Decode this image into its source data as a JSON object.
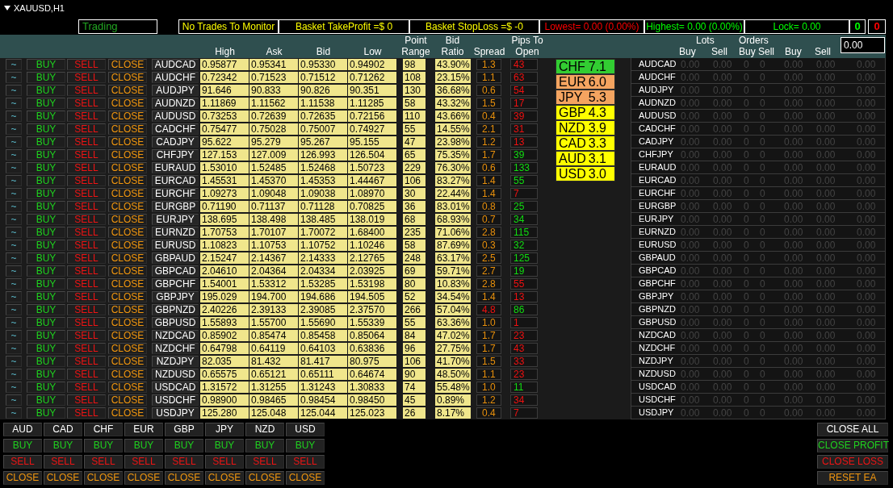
{
  "window": {
    "title": "XAUUSD,H1"
  },
  "mode": "Trading",
  "status": [
    {
      "text": "No Trades To Monitor",
      "color": "#ffff00"
    },
    {
      "text": "Basket TakeProfit =$ 0",
      "color": "#ffff00"
    },
    {
      "text": "Basket StopLoss =$ -0",
      "color": "#ffff00"
    },
    {
      "text": "Lowest= 0.00 (0.00%)",
      "color": "#ff0000"
    },
    {
      "text": "Highest= 0.00 (0.00%)",
      "color": "#00ff00"
    },
    {
      "text": "Lock= 0.00",
      "color": "#00ff00"
    },
    {
      "text": "0",
      "color": "#00ff00"
    },
    {
      "text": "0",
      "color": "#ff0000"
    }
  ],
  "table": {
    "columns": [
      "High",
      "Ask",
      "Bid",
      "Low",
      "Point Range",
      "Bid Ratio",
      "Spread",
      "Pips To Open"
    ],
    "rows": [
      {
        "actions": [
          "~",
          "BUY",
          "SELL",
          "CLOSE"
        ],
        "pair": "AUDCAD",
        "high": "0.95877",
        "ask": "0.95341",
        "bid": "0.95330",
        "low": "0.94902",
        "point_range": "98",
        "bid_ratio": "43.90%",
        "spread": {
          "text": "1.3",
          "color": "#e8900c"
        },
        "pips_to_open": {
          "text": "43",
          "color": "#ee1111"
        }
      },
      {
        "actions": [
          "~",
          "BUY",
          "SELL",
          "CLOSE"
        ],
        "pair": "AUDCHF",
        "high": "0.72342",
        "ask": "0.71523",
        "bid": "0.71512",
        "low": "0.71262",
        "point_range": "108",
        "bid_ratio": "23.15%",
        "spread": {
          "text": "1.1",
          "color": "#e8900c"
        },
        "pips_to_open": {
          "text": "63",
          "color": "#ee1111"
        }
      },
      {
        "actions": [
          "~",
          "BUY",
          "SELL",
          "CLOSE"
        ],
        "pair": "AUDJPY",
        "high": "91.646",
        "ask": "90.833",
        "bid": "90.826",
        "low": "90.351",
        "point_range": "130",
        "bid_ratio": "36.68%",
        "spread": {
          "text": "0.6",
          "color": "#e8900c"
        },
        "pips_to_open": {
          "text": "54",
          "color": "#ee1111"
        }
      },
      {
        "actions": [
          "~",
          "BUY",
          "SELL",
          "CLOSE"
        ],
        "pair": "AUDNZD",
        "high": "1.11869",
        "ask": "1.11562",
        "bid": "1.11538",
        "low": "1.11285",
        "point_range": "58",
        "bid_ratio": "43.32%",
        "spread": {
          "text": "1.5",
          "color": "#e8900c"
        },
        "pips_to_open": {
          "text": "17",
          "color": "#ee1111"
        }
      },
      {
        "actions": [
          "~",
          "BUY",
          "SELL",
          "CLOSE"
        ],
        "pair": "AUDUSD",
        "high": "0.73253",
        "ask": "0.72639",
        "bid": "0.72635",
        "low": "0.72156",
        "point_range": "110",
        "bid_ratio": "43.66%",
        "spread": {
          "text": "0.4",
          "color": "#e8900c"
        },
        "pips_to_open": {
          "text": "39",
          "color": "#ee1111"
        }
      },
      {
        "actions": [
          "~",
          "BUY",
          "SELL",
          "CLOSE"
        ],
        "pair": "CADCHF",
        "high": "0.75477",
        "ask": "0.75028",
        "bid": "0.75007",
        "low": "0.74927",
        "point_range": "55",
        "bid_ratio": "14.55%",
        "spread": {
          "text": "2.1",
          "color": "#e8900c"
        },
        "pips_to_open": {
          "text": "31",
          "color": "#ee1111"
        }
      },
      {
        "actions": [
          "~",
          "BUY",
          "SELL",
          "CLOSE"
        ],
        "pair": "CADJPY",
        "high": "95.622",
        "ask": "95.279",
        "bid": "95.267",
        "low": "95.155",
        "point_range": "47",
        "bid_ratio": "23.98%",
        "spread": {
          "text": "1.2",
          "color": "#e8900c"
        },
        "pips_to_open": {
          "text": "13",
          "color": "#ee1111"
        }
      },
      {
        "actions": [
          "~",
          "BUY",
          "SELL",
          "CLOSE"
        ],
        "pair": "CHFJPY",
        "high": "127.153",
        "ask": "127.009",
        "bid": "126.993",
        "low": "126.504",
        "point_range": "65",
        "bid_ratio": "75.35%",
        "spread": {
          "text": "1.7",
          "color": "#e8900c"
        },
        "pips_to_open": {
          "text": "39",
          "color": "#11dd11"
        }
      },
      {
        "actions": [
          "~",
          "BUY",
          "SELL",
          "CLOSE"
        ],
        "pair": "EURAUD",
        "high": "1.53010",
        "ask": "1.52485",
        "bid": "1.52468",
        "low": "1.50723",
        "point_range": "229",
        "bid_ratio": "76.30%",
        "spread": {
          "text": "0.6",
          "color": "#e8900c"
        },
        "pips_to_open": {
          "text": "133",
          "color": "#11dd11"
        }
      },
      {
        "actions": [
          "~",
          "BUY",
          "SELL",
          "CLOSE"
        ],
        "pair": "EURCAD",
        "high": "1.45531",
        "ask": "1.45370",
        "bid": "1.45353",
        "low": "1.44467",
        "point_range": "106",
        "bid_ratio": "83.27%",
        "spread": {
          "text": "1.4",
          "color": "#e8900c"
        },
        "pips_to_open": {
          "text": "55",
          "color": "#11dd11"
        }
      },
      {
        "actions": [
          "~",
          "BUY",
          "SELL",
          "CLOSE"
        ],
        "pair": "EURCHF",
        "high": "1.09273",
        "ask": "1.09048",
        "bid": "1.09038",
        "low": "1.08970",
        "point_range": "30",
        "bid_ratio": "22.44%",
        "spread": {
          "text": "1.4",
          "color": "#e8900c"
        },
        "pips_to_open": {
          "text": "7",
          "color": "#ee1111"
        }
      },
      {
        "actions": [
          "~",
          "BUY",
          "SELL",
          "CLOSE"
        ],
        "pair": "EURGBP",
        "high": "0.71190",
        "ask": "0.71137",
        "bid": "0.71128",
        "low": "0.70825",
        "point_range": "36",
        "bid_ratio": "83.01%",
        "spread": {
          "text": "0.8",
          "color": "#e8900c"
        },
        "pips_to_open": {
          "text": "25",
          "color": "#11dd11"
        }
      },
      {
        "actions": [
          "~",
          "BUY",
          "SELL",
          "CLOSE"
        ],
        "pair": "EURJPY",
        "high": "138.695",
        "ask": "138.498",
        "bid": "138.485",
        "low": "138.019",
        "point_range": "68",
        "bid_ratio": "68.93%",
        "spread": {
          "text": "0.7",
          "color": "#e8900c"
        },
        "pips_to_open": {
          "text": "34",
          "color": "#11dd11"
        }
      },
      {
        "actions": [
          "~",
          "BUY",
          "SELL",
          "CLOSE"
        ],
        "pair": "EURNZD",
        "high": "1.70753",
        "ask": "1.70107",
        "bid": "1.70072",
        "low": "1.68400",
        "point_range": "235",
        "bid_ratio": "71.06%",
        "spread": {
          "text": "2.8",
          "color": "#e8900c"
        },
        "pips_to_open": {
          "text": "115",
          "color": "#11dd11"
        }
      },
      {
        "actions": [
          "~",
          "BUY",
          "SELL",
          "CLOSE"
        ],
        "pair": "EURUSD",
        "high": "1.10823",
        "ask": "1.10753",
        "bid": "1.10752",
        "low": "1.10246",
        "point_range": "58",
        "bid_ratio": "87.69%",
        "spread": {
          "text": "0.3",
          "color": "#e8900c"
        },
        "pips_to_open": {
          "text": "32",
          "color": "#11dd11"
        }
      },
      {
        "actions": [
          "~",
          "BUY",
          "SELL",
          "CLOSE"
        ],
        "pair": "GBPAUD",
        "high": "2.15247",
        "ask": "2.14367",
        "bid": "2.14333",
        "low": "2.12765",
        "point_range": "248",
        "bid_ratio": "63.17%",
        "spread": {
          "text": "2.5",
          "color": "#e8900c"
        },
        "pips_to_open": {
          "text": "125",
          "color": "#11dd11"
        }
      },
      {
        "actions": [
          "~",
          "BUY",
          "SELL",
          "CLOSE"
        ],
        "pair": "GBPCAD",
        "high": "2.04610",
        "ask": "2.04364",
        "bid": "2.04334",
        "low": "2.03925",
        "point_range": "69",
        "bid_ratio": "59.71%",
        "spread": {
          "text": "2.7",
          "color": "#e8900c"
        },
        "pips_to_open": {
          "text": "19",
          "color": "#11dd11"
        }
      },
      {
        "actions": [
          "~",
          "BUY",
          "SELL",
          "CLOSE"
        ],
        "pair": "GBPCHF",
        "high": "1.54001",
        "ask": "1.53312",
        "bid": "1.53285",
        "low": "1.53198",
        "point_range": "80",
        "bid_ratio": "10.83%",
        "spread": {
          "text": "2.8",
          "color": "#e8900c"
        },
        "pips_to_open": {
          "text": "55",
          "color": "#ee1111"
        }
      },
      {
        "actions": [
          "~",
          "BUY",
          "SELL",
          "CLOSE"
        ],
        "pair": "GBPJPY",
        "high": "195.029",
        "ask": "194.700",
        "bid": "194.686",
        "low": "194.505",
        "point_range": "52",
        "bid_ratio": "34.54%",
        "spread": {
          "text": "1.4",
          "color": "#e8900c"
        },
        "pips_to_open": {
          "text": "13",
          "color": "#ee1111"
        }
      },
      {
        "actions": [
          "~",
          "BUY",
          "SELL",
          "CLOSE"
        ],
        "pair": "GBPNZD",
        "high": "2.40226",
        "ask": "2.39133",
        "bid": "2.39085",
        "low": "2.37570",
        "point_range": "266",
        "bid_ratio": "57.04%",
        "spread": {
          "text": "4.8",
          "color": "#ee1111"
        },
        "pips_to_open": {
          "text": "86",
          "color": "#11dd11"
        }
      },
      {
        "actions": [
          "~",
          "BUY",
          "SELL",
          "CLOSE"
        ],
        "pair": "GBPUSD",
        "high": "1.55893",
        "ask": "1.55700",
        "bid": "1.55690",
        "low": "1.55339",
        "point_range": "55",
        "bid_ratio": "63.36%",
        "spread": {
          "text": "1.0",
          "color": "#e8900c"
        },
        "pips_to_open": {
          "text": "1",
          "color": "#ee1111"
        }
      },
      {
        "actions": [
          "~",
          "BUY",
          "SELL",
          "CLOSE"
        ],
        "pair": "NZDCAD",
        "high": "0.85902",
        "ask": "0.85474",
        "bid": "0.85458",
        "low": "0.85064",
        "point_range": "84",
        "bid_ratio": "47.02%",
        "spread": {
          "text": "1.7",
          "color": "#e8900c"
        },
        "pips_to_open": {
          "text": "23",
          "color": "#ee1111"
        }
      },
      {
        "actions": [
          "~",
          "BUY",
          "SELL",
          "CLOSE"
        ],
        "pair": "NZDCHF",
        "high": "0.64798",
        "ask": "0.64119",
        "bid": "0.64103",
        "low": "0.63836",
        "point_range": "96",
        "bid_ratio": "27.75%",
        "spread": {
          "text": "1.7",
          "color": "#e8900c"
        },
        "pips_to_open": {
          "text": "43",
          "color": "#ee1111"
        }
      },
      {
        "actions": [
          "~",
          "BUY",
          "SELL",
          "CLOSE"
        ],
        "pair": "NZDJPY",
        "high": "82.035",
        "ask": "81.432",
        "bid": "81.417",
        "low": "80.975",
        "point_range": "106",
        "bid_ratio": "41.70%",
        "spread": {
          "text": "1.5",
          "color": "#e8900c"
        },
        "pips_to_open": {
          "text": "33",
          "color": "#ee1111"
        }
      },
      {
        "actions": [
          "~",
          "BUY",
          "SELL",
          "CLOSE"
        ],
        "pair": "NZDUSD",
        "high": "0.65575",
        "ask": "0.65121",
        "bid": "0.65111",
        "low": "0.64674",
        "point_range": "90",
        "bid_ratio": "48.50%",
        "spread": {
          "text": "1.1",
          "color": "#e8900c"
        },
        "pips_to_open": {
          "text": "23",
          "color": "#ee1111"
        }
      },
      {
        "actions": [
          "~",
          "BUY",
          "SELL",
          "CLOSE"
        ],
        "pair": "USDCAD",
        "high": "1.31572",
        "ask": "1.31255",
        "bid": "1.31243",
        "low": "1.30833",
        "point_range": "74",
        "bid_ratio": "55.48%",
        "spread": {
          "text": "1.0",
          "color": "#e8900c"
        },
        "pips_to_open": {
          "text": "11",
          "color": "#11dd11"
        }
      },
      {
        "actions": [
          "~",
          "BUY",
          "SELL",
          "CLOSE"
        ],
        "pair": "USDCHF",
        "high": "0.98900",
        "ask": "0.98465",
        "bid": "0.98454",
        "low": "0.98450",
        "point_range": "45",
        "bid_ratio": "0.89%",
        "spread": {
          "text": "1.2",
          "color": "#e8900c"
        },
        "pips_to_open": {
          "text": "34",
          "color": "#ee1111"
        }
      },
      {
        "actions": [
          "~",
          "BUY",
          "SELL",
          "CLOSE"
        ],
        "pair": "USDJPY",
        "high": "125.280",
        "ask": "125.048",
        "bid": "125.044",
        "low": "125.023",
        "point_range": "26",
        "bid_ratio": "8.17%",
        "spread": {
          "text": "0.4",
          "color": "#e8900c"
        },
        "pips_to_open": {
          "text": "7",
          "color": "#ee1111"
        }
      }
    ]
  },
  "currency_strength": [
    {
      "currency": "CHF",
      "value": "7.1",
      "color": "#32cd32"
    },
    {
      "currency": "EUR",
      "value": "6.0",
      "color": "#f4a460"
    },
    {
      "currency": "JPY",
      "value": "5.3",
      "color": "#f4a460"
    },
    {
      "currency": "GBP",
      "value": "4.3",
      "color": "#ffff00"
    },
    {
      "currency": "NZD",
      "value": "3.9",
      "color": "#ffff00"
    },
    {
      "currency": "CAD",
      "value": "3.3",
      "color": "#ffff00"
    },
    {
      "currency": "AUD",
      "value": "3.1",
      "color": "#ffff00"
    },
    {
      "currency": "USD",
      "value": "3.0",
      "color": "#ffff00"
    }
  ],
  "positions": {
    "header": [
      {
        "group": "Lots",
        "labels": [
          "Buy",
          "Sell"
        ]
      },
      {
        "group": "Orders",
        "labels": [
          "Buy",
          "Sell"
        ]
      },
      {
        "labels": [
          "Buy",
          "Sell"
        ]
      }
    ],
    "input": {
      "value": "0.00"
    },
    "rows": [
      {
        "pair": "AUDCAD",
        "values": [
          "0.00",
          "0.00",
          "0",
          "0",
          "0.00",
          "0.00",
          "0.00"
        ]
      },
      {
        "pair": "AUDCHF",
        "values": [
          "0.00",
          "0.00",
          "0",
          "0",
          "0.00",
          "0.00",
          "0.00"
        ]
      },
      {
        "pair": "AUDJPY",
        "values": [
          "0.00",
          "0.00",
          "0",
          "0",
          "0.00",
          "0.00",
          "0.00"
        ]
      },
      {
        "pair": "AUDNZD",
        "values": [
          "0.00",
          "0.00",
          "0",
          "0",
          "0.00",
          "0.00",
          "0.00"
        ]
      },
      {
        "pair": "AUDUSD",
        "values": [
          "0.00",
          "0.00",
          "0",
          "0",
          "0.00",
          "0.00",
          "0.00"
        ]
      },
      {
        "pair": "CADCHF",
        "values": [
          "0.00",
          "0.00",
          "0",
          "0",
          "0.00",
          "0.00",
          "0.00"
        ]
      },
      {
        "pair": "CADJPY",
        "values": [
          "0.00",
          "0.00",
          "0",
          "0",
          "0.00",
          "0.00",
          "0.00"
        ]
      },
      {
        "pair": "CHFJPY",
        "values": [
          "0.00",
          "0.00",
          "0",
          "0",
          "0.00",
          "0.00",
          "0.00"
        ]
      },
      {
        "pair": "EURAUD",
        "values": [
          "0.00",
          "0.00",
          "0",
          "0",
          "0.00",
          "0.00",
          "0.00"
        ]
      },
      {
        "pair": "EURCAD",
        "values": [
          "0.00",
          "0.00",
          "0",
          "0",
          "0.00",
          "0.00",
          "0.00"
        ]
      },
      {
        "pair": "EURCHF",
        "values": [
          "0.00",
          "0.00",
          "0",
          "0",
          "0.00",
          "0.00",
          "0.00"
        ]
      },
      {
        "pair": "EURGBP",
        "values": [
          "0.00",
          "0.00",
          "0",
          "0",
          "0.00",
          "0.00",
          "0.00"
        ]
      },
      {
        "pair": "EURJPY",
        "values": [
          "0.00",
          "0.00",
          "0",
          "0",
          "0.00",
          "0.00",
          "0.00"
        ]
      },
      {
        "pair": "EURNZD",
        "values": [
          "0.00",
          "0.00",
          "0",
          "0",
          "0.00",
          "0.00",
          "0.00"
        ]
      },
      {
        "pair": "EURUSD",
        "values": [
          "0.00",
          "0.00",
          "0",
          "0",
          "0.00",
          "0.00",
          "0.00"
        ]
      },
      {
        "pair": "GBPAUD",
        "values": [
          "0.00",
          "0.00",
          "0",
          "0",
          "0.00",
          "0.00",
          "0.00"
        ]
      },
      {
        "pair": "GBPCAD",
        "values": [
          "0.00",
          "0.00",
          "0",
          "0",
          "0.00",
          "0.00",
          "0.00"
        ]
      },
      {
        "pair": "GBPCHF",
        "values": [
          "0.00",
          "0.00",
          "0",
          "0",
          "0.00",
          "0.00",
          "0.00"
        ]
      },
      {
        "pair": "GBPJPY",
        "values": [
          "0.00",
          "0.00",
          "0",
          "0",
          "0.00",
          "0.00",
          "0.00"
        ]
      },
      {
        "pair": "GBPNZD",
        "values": [
          "0.00",
          "0.00",
          "0",
          "0",
          "0.00",
          "0.00",
          "0.00"
        ]
      },
      {
        "pair": "GBPUSD",
        "values": [
          "0.00",
          "0.00",
          "0",
          "0",
          "0.00",
          "0.00",
          "0.00"
        ]
      },
      {
        "pair": "NZDCAD",
        "values": [
          "0.00",
          "0.00",
          "0",
          "0",
          "0.00",
          "0.00",
          "0.00"
        ]
      },
      {
        "pair": "NZDCHF",
        "values": [
          "0.00",
          "0.00",
          "0",
          "0",
          "0.00",
          "0.00",
          "0.00"
        ]
      },
      {
        "pair": "NZDJPY",
        "values": [
          "0.00",
          "0.00",
          "0",
          "0",
          "0.00",
          "0.00",
          "0.00"
        ]
      },
      {
        "pair": "NZDUSD",
        "values": [
          "0.00",
          "0.00",
          "0",
          "0",
          "0.00",
          "0.00",
          "0.00"
        ]
      },
      {
        "pair": "USDCAD",
        "values": [
          "0.00",
          "0.00",
          "0",
          "0",
          "0.00",
          "0.00",
          "0.00"
        ]
      },
      {
        "pair": "USDCHF",
        "values": [
          "0.00",
          "0.00",
          "0",
          "0",
          "0.00",
          "0.00",
          "0.00"
        ]
      },
      {
        "pair": "USDJPY",
        "values": [
          "0.00",
          "0.00",
          "0",
          "0",
          "0.00",
          "0.00",
          "0.00"
        ]
      }
    ]
  },
  "currency_buttons": [
    {
      "currency": "AUD",
      "buttons": [
        "BUY",
        "SELL",
        "CLOSE"
      ]
    },
    {
      "currency": "CAD",
      "buttons": [
        "BUY",
        "SELL",
        "CLOSE"
      ]
    },
    {
      "currency": "CHF",
      "buttons": [
        "BUY",
        "SELL",
        "CLOSE"
      ]
    },
    {
      "currency": "EUR",
      "buttons": [
        "BUY",
        "SELL",
        "CLOSE"
      ]
    },
    {
      "currency": "GBP",
      "buttons": [
        "BUY",
        "SELL",
        "CLOSE"
      ]
    },
    {
      "currency": "JPY",
      "buttons": [
        "BUY",
        "SELL",
        "CLOSE"
      ]
    },
    {
      "currency": "NZD",
      "buttons": [
        "BUY",
        "SELL",
        "CLOSE"
      ]
    },
    {
      "currency": "USD",
      "buttons": [
        "BUY",
        "SELL",
        "CLOSE"
      ]
    }
  ],
  "commands": [
    {
      "kind": "all",
      "label": "CLOSE ALL"
    },
    {
      "kind": "profit",
      "label": "CLOSE PROFIT"
    },
    {
      "kind": "loss",
      "label": "CLOSE LOSS"
    },
    {
      "kind": "reset",
      "label": "RESET EA"
    }
  ]
}
